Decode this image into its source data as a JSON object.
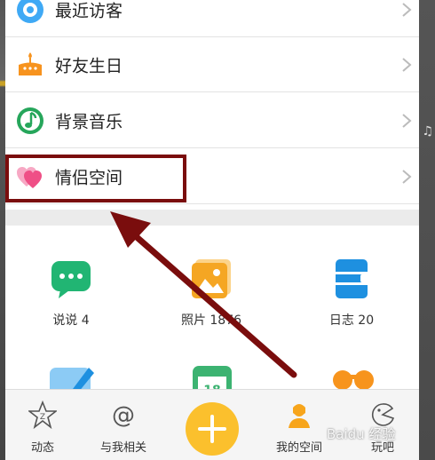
{
  "menu": {
    "items": [
      {
        "label": "最近访客",
        "icon": "visitor-icon"
      },
      {
        "label": "好友生日",
        "icon": "birthday-cake-icon"
      },
      {
        "label": "背景音乐",
        "icon": "music-note-icon"
      },
      {
        "label": "情侣空间",
        "icon": "hearts-icon"
      }
    ]
  },
  "features": [
    {
      "label": "说说 4",
      "icon": "chat-bubble-icon"
    },
    {
      "label": "照片 1876",
      "icon": "photo-icon"
    },
    {
      "label": "日志 20",
      "icon": "journal-icon"
    }
  ],
  "bottom_nav": {
    "tabs": [
      {
        "label": "动态",
        "icon": "star-icon"
      },
      {
        "label": "与我相关",
        "icon": "at-icon"
      },
      {
        "label": "我的空间",
        "icon": "profile-icon"
      },
      {
        "label": "玩吧",
        "icon": "game-icon"
      }
    ]
  },
  "watermark": "Baidu 经验",
  "colors": {
    "highlight": "#7a0d0d",
    "accent": "#fbc02d",
    "chat": "#21b573",
    "photo": "#f5a623",
    "journal": "#1e90e0"
  }
}
